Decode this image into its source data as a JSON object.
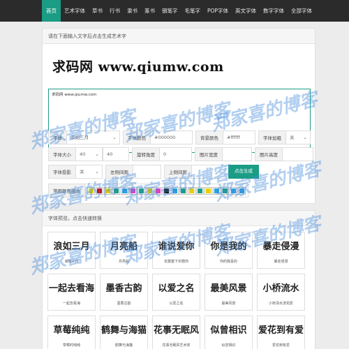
{
  "nav": {
    "items": [
      "首页",
      "艺术字体",
      "草书",
      "行书",
      "隶书",
      "篆书",
      "钢笔字",
      "毛笔字",
      "POP字体",
      "英文字体",
      "数字字体",
      "全部字体"
    ],
    "active": "首页"
  },
  "editor": {
    "heading": "请在下面输入文字后点击生成艺术字",
    "preview_text": "求码网 www.qiumw.com",
    "textarea_value": "求码网 www.qiumw.com",
    "labels": {
      "font": "字体",
      "font_color": "字体颜色",
      "bg_color": "背景颜色",
      "bold": "字体加粗",
      "size": "字体大小",
      "rotate": "旋转角度",
      "img_width": "图片宽度",
      "img_height": "图片高度",
      "shadow": "字体投影",
      "left_margin": "左侧间距",
      "top_margin": "上侧间距",
      "common_colors": "常用颜色组合"
    },
    "values": {
      "font": "浪如三月",
      "font_color": "#000000",
      "bg_color": "#ffffff",
      "bold": "关",
      "size_select": "40",
      "size_input": "40",
      "rotate": "0",
      "img_width": "",
      "img_height": "",
      "shadow": "关",
      "left_margin": "",
      "top_margin": ""
    },
    "generate_label": "点击生成",
    "swatches": [
      "#e8d000",
      "#d40000",
      "#e8d000",
      "#1b9c85",
      "#29a0e0",
      "#e040c0",
      "#1b9c85",
      "#e8d000",
      "#e040c0",
      "#111111",
      "#29a0e0",
      "#1b9c85",
      "#e8d000",
      "#1b9c85",
      "#e8d000",
      "#29a0e0",
      "#1b9c85",
      "#29a0e0",
      "#29a0e0"
    ]
  },
  "previews": {
    "heading": "字体预览，点击快速转换",
    "items": [
      {
        "art": "浪如三月",
        "caption": "浪如三月"
      },
      {
        "art": "月亮船",
        "caption": "月亮船"
      },
      {
        "art": "谁说爱你",
        "caption": "花蕾蜜下灰鹦你"
      },
      {
        "art": "你是我的",
        "caption": "你的我喜的"
      },
      {
        "art": "暴走侵漫",
        "caption": "暴走侵漫"
      },
      {
        "art": "一起去看海",
        "caption": "一起去看海"
      },
      {
        "art": "墨香古韵",
        "caption": "墨香古韵"
      },
      {
        "art": "以爱之名",
        "caption": "以爱之名"
      },
      {
        "art": "最美风景",
        "caption": "最美风景"
      },
      {
        "art": "小桥流水",
        "caption": "小桥清水流花影"
      },
      {
        "art": "草莓纯纯",
        "caption": "草莓时纯纯"
      },
      {
        "art": "鹤舞与海猫",
        "caption": "鹤舞与海猫"
      },
      {
        "art": "花事无眠风",
        "caption": "花事无眠风艺术体"
      },
      {
        "art": "似曾相识",
        "caption": "似曾相识"
      },
      {
        "art": "爱花到有爱",
        "caption": "爱花到有爱"
      }
    ]
  },
  "watermark": "郑家喜的博客"
}
